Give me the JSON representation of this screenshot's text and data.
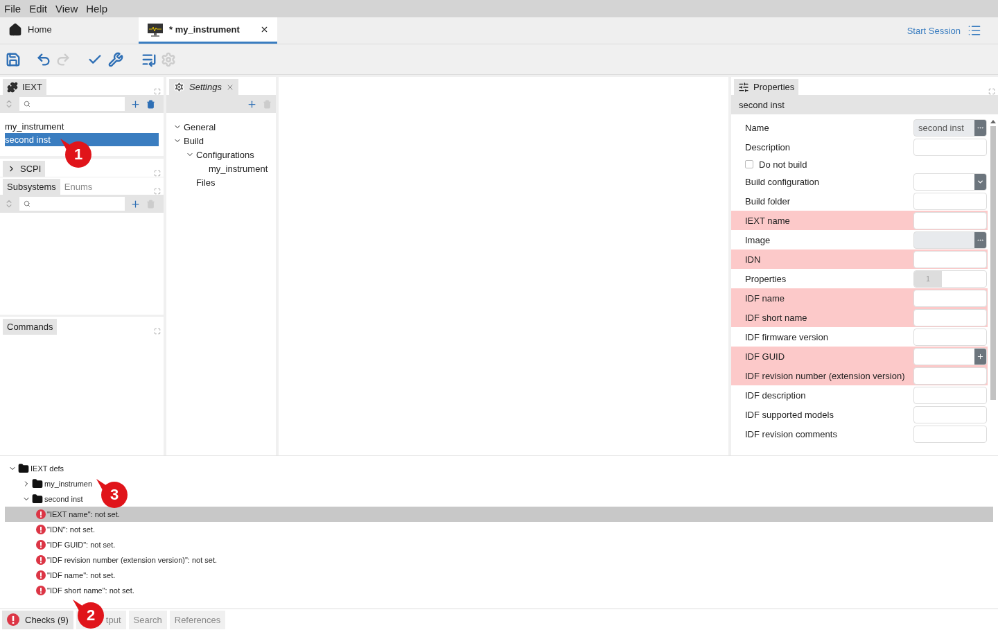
{
  "menu": [
    "File",
    "Edit",
    "View",
    "Help"
  ],
  "doc_tabs": [
    {
      "label": "Home",
      "kind": "home",
      "selected": false,
      "closable": false
    },
    {
      "label": "* my_instrument",
      "kind": "instrument",
      "selected": true,
      "closable": true
    }
  ],
  "start_session": "Start Session",
  "toolbar": [
    {
      "kind": "save",
      "disabled": false
    },
    {
      "kind": "undo",
      "disabled": false
    },
    {
      "kind": "redo",
      "disabled": true
    },
    {
      "kind": "check",
      "disabled": false
    },
    {
      "kind": "wrench",
      "disabled": false
    },
    {
      "kind": "list",
      "disabled": false
    },
    {
      "kind": "gear",
      "disabled": true
    }
  ],
  "iext_panel": {
    "title": "IEXT",
    "items": [
      {
        "label": "my_instrument",
        "selected": false
      },
      {
        "label": "second inst",
        "selected": true
      }
    ]
  },
  "scpi_panel": {
    "title": "SCPI",
    "expanded": false,
    "tabs": [
      {
        "label": "Subsystems",
        "selected": true
      },
      {
        "label": "Enums",
        "selected": false
      }
    ]
  },
  "commands_panel": {
    "title": "Commands"
  },
  "settings_panel": {
    "title": "Settings",
    "tree": [
      {
        "label": "General",
        "expanded": true
      },
      {
        "label": "Build",
        "expanded": true,
        "children": [
          {
            "label": "Configurations",
            "expanded": true,
            "children": [
              {
                "label": "my_instrument"
              }
            ]
          },
          {
            "label": "Files"
          }
        ]
      }
    ]
  },
  "properties": {
    "title": "Properties",
    "subtitle": "second inst",
    "rows": [
      {
        "label": "Name",
        "kind": "dialog",
        "invalid": false,
        "value": "second inst"
      },
      {
        "label": "Description",
        "kind": "text",
        "invalid": false
      },
      {
        "label": "Do not build",
        "kind": "checkbox",
        "invalid": false,
        "checked": false
      },
      {
        "label": "Build configuration",
        "kind": "select",
        "invalid": false
      },
      {
        "label": "Build folder",
        "kind": "text",
        "invalid": false
      },
      {
        "label": "IEXT name",
        "kind": "text",
        "invalid": true
      },
      {
        "label": "Image",
        "kind": "dialog",
        "invalid": false
      },
      {
        "label": "IDN",
        "kind": "text",
        "invalid": true
      },
      {
        "label": "Properties",
        "kind": "spin",
        "invalid": false,
        "value": "1"
      },
      {
        "label": "IDF name",
        "kind": "text",
        "invalid": true
      },
      {
        "label": "IDF short name",
        "kind": "text",
        "invalid": true
      },
      {
        "label": "IDF firmware version",
        "kind": "text",
        "invalid": false
      },
      {
        "label": "IDF GUID",
        "kind": "guid",
        "invalid": true
      },
      {
        "label": "IDF revision number (extension version)",
        "kind": "text",
        "invalid": true
      },
      {
        "label": "IDF description",
        "kind": "text",
        "invalid": false
      },
      {
        "label": "IDF supported models",
        "kind": "text",
        "invalid": false
      },
      {
        "label": "IDF revision comments",
        "kind": "text",
        "invalid": false
      }
    ]
  },
  "checks": [
    {
      "label": "IEXT defs",
      "kind": "folder",
      "expanded": true,
      "selected": false,
      "children": [
        {
          "label": "my_instrumen",
          "kind": "folder",
          "expanded": false,
          "selected": false
        },
        {
          "label": "second inst",
          "kind": "folder",
          "expanded": true,
          "selected": false,
          "children": [
            {
              "label": "\"IEXT name\": not set.",
              "kind": "error",
              "selected": true
            },
            {
              "label": "\"IDN\": not set.",
              "kind": "error",
              "selected": false
            },
            {
              "label": "\"IDF GUID\": not set.",
              "kind": "error",
              "selected": false
            },
            {
              "label": "\"IDF revision number (extension version)\": not set.",
              "kind": "error",
              "selected": false
            },
            {
              "label": "\"IDF name\": not set.",
              "kind": "error",
              "selected": false
            },
            {
              "label": "\"IDF short name\": not set.",
              "kind": "error",
              "selected": false
            }
          ]
        }
      ]
    }
  ],
  "bottom_tabs": [
    {
      "label": "Checks (9)",
      "kind": "checks",
      "selected": true
    },
    {
      "label": "tput",
      "kind": "output",
      "selected": false
    },
    {
      "label": "Search",
      "kind": "plain",
      "selected": false
    },
    {
      "label": "References",
      "kind": "plain",
      "selected": false
    }
  ],
  "callouts": [
    "1",
    "2",
    "3"
  ]
}
